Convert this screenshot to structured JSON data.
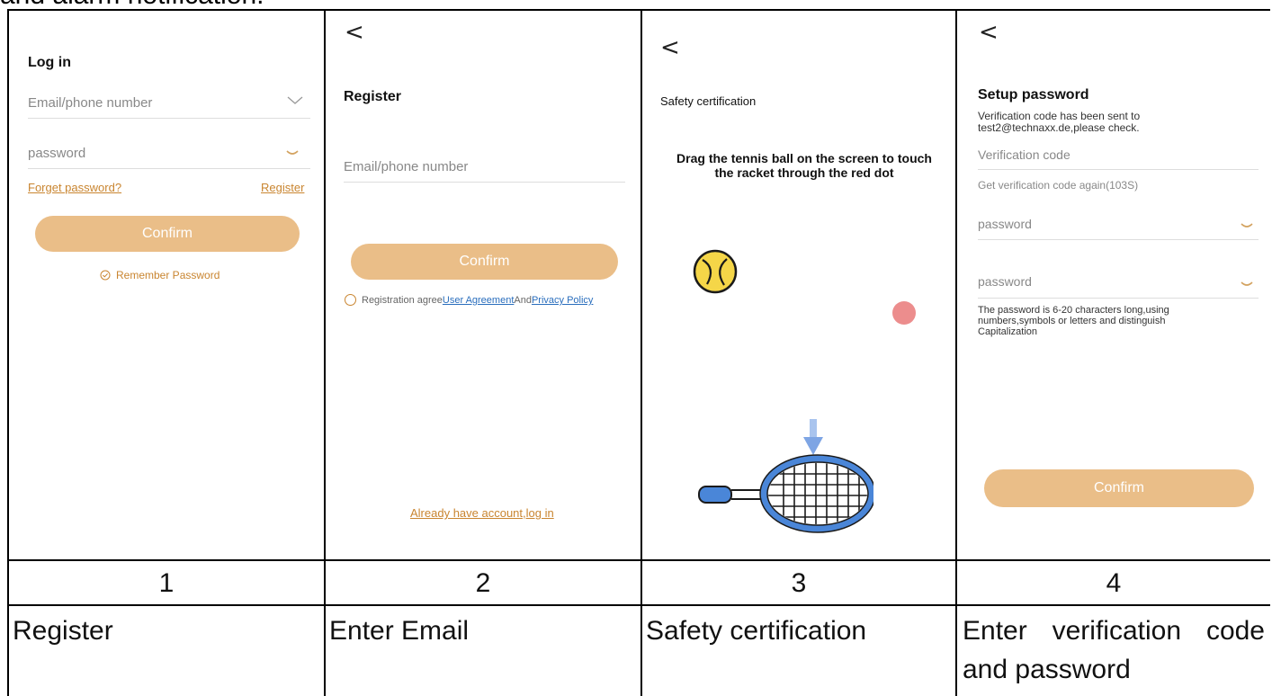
{
  "top_caption": "and alarm notification.",
  "screens": {
    "login": {
      "title": "Log in",
      "email_placeholder": "Email/phone number",
      "password_placeholder": "password",
      "forget_link": "Forget password?",
      "register_link": "Register",
      "confirm_label": "Confirm",
      "remember_label": "Remember Password"
    },
    "register": {
      "back": "<",
      "title": "Register",
      "email_placeholder": "Email/phone number",
      "confirm_label": "Confirm",
      "agree_prefix": "Registration agree",
      "agreement_link": "User Agreement",
      "and_text": "And",
      "privacy_link": "Privacy Policy",
      "login_link": "Already have account,log in"
    },
    "safety": {
      "back": "<",
      "title": "Safety certification",
      "instruction": "Drag the tennis ball on the screen to touch the racket through the red dot"
    },
    "setup": {
      "back": "<",
      "title": "Setup password",
      "sent_line1": "Verification code has been sent to",
      "sent_line2": "test2@technaxx.de,please check.",
      "code_placeholder": "Verification code",
      "resend": "Get verification code again(103S)",
      "password_placeholder": "password",
      "password2_placeholder": "password",
      "rule": "The password is 6-20 characters long,using numbers,symbols or letters and distinguish Capitalization",
      "confirm_label": "Confirm"
    }
  },
  "table": {
    "numbers": [
      "1",
      "2",
      "3",
      "4"
    ],
    "captions": [
      "Register",
      "Enter Email",
      "Safety certification",
      "Enter verification code and password"
    ]
  },
  "colors": {
    "button": "#e9bb82",
    "link_orange": "#c98530",
    "link_blue": "#2a6ebd",
    "dot_red": "#ec8d8d",
    "ball_yellow": "#f5d648"
  }
}
